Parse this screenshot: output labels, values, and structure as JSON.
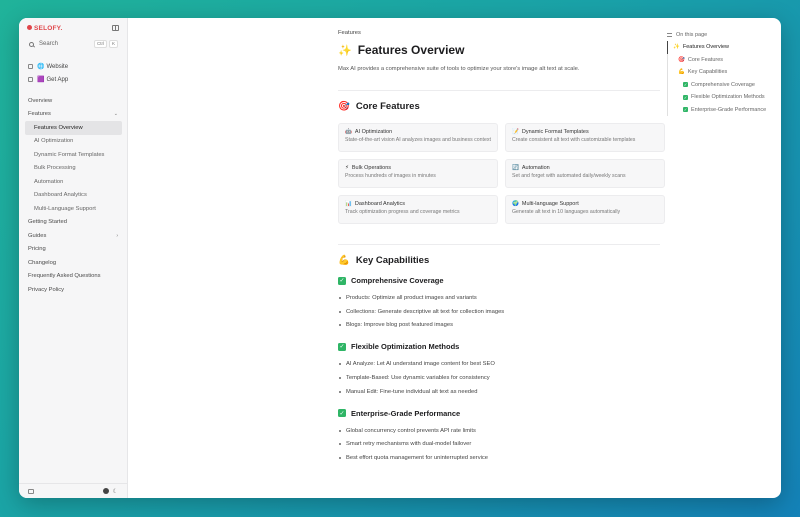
{
  "sidebar": {
    "brand": "SELOFY.",
    "search": {
      "placeholder": "Search",
      "kbd_ctrl": "Ctrl",
      "kbd_k": "K"
    },
    "links": [
      {
        "emoji": "🌐",
        "label": "Website"
      },
      {
        "emoji": "🟪",
        "label": "Get App"
      }
    ],
    "nav": [
      {
        "label": "Overview"
      },
      {
        "label": "Features",
        "chevron": "⌄"
      },
      {
        "label": "Features Overview"
      },
      {
        "label": "AI Optimization"
      },
      {
        "label": "Dynamic Format Templates"
      },
      {
        "label": "Bulk Processing"
      },
      {
        "label": "Automation"
      },
      {
        "label": "Dashboard Analytics"
      },
      {
        "label": "Multi-Language Support"
      },
      {
        "label": "Getting Started"
      },
      {
        "label": "Guides",
        "chevron": "›"
      },
      {
        "label": "Pricing"
      },
      {
        "label": "Changelog"
      },
      {
        "label": "Frequently Asked Questions"
      },
      {
        "label": "Privacy Policy"
      }
    ]
  },
  "main": {
    "breadcrumb": "Features",
    "title_emoji": "✨",
    "title": "Features Overview",
    "lede": "Max AI provides a comprehensive suite of tools to optimize your store's image alt text at scale.",
    "core": {
      "emoji": "🎯",
      "title": "Core Features",
      "cards": [
        {
          "icon": "🤖",
          "title": "AI Optimization",
          "desc": "State-of-the-art vision AI analyzes images and business context"
        },
        {
          "icon": "📝",
          "title": "Dynamic Format Templates",
          "desc": "Create consistent alt text with customizable templates"
        },
        {
          "icon": "⚡",
          "title": "Bulk Operations",
          "desc": "Process hundreds of images in minutes"
        },
        {
          "icon": "🔄",
          "title": "Automation",
          "desc": "Set and forget with automated daily/weekly scans"
        },
        {
          "icon": "📊",
          "title": "Dashboard Analytics",
          "desc": "Track optimization progress and coverage metrics"
        },
        {
          "icon": "🌍",
          "title": "Multi-language Support",
          "desc": "Generate alt text in 10 languages automatically"
        }
      ]
    },
    "capabilities": {
      "emoji": "💪",
      "title": "Key Capabilities",
      "groups": [
        {
          "title": "Comprehensive Coverage",
          "items": [
            "Products: Optimize all product images and variants",
            "Collections: Generate descriptive alt text for collection images",
            "Blogs: Improve blog post featured images"
          ]
        },
        {
          "title": "Flexible Optimization Methods",
          "items": [
            "AI Analyze: Let AI understand image content for best SEO",
            "Template-Based: Use dynamic variables for consistency",
            "Manual Edit: Fine-tune individual alt text as needed"
          ]
        },
        {
          "title": "Enterprise-Grade Performance",
          "items": [
            "Global concurrency control prevents API rate limits",
            "Smart retry mechanisms with dual-model failover",
            "Best effort quota management for uninterrupted service"
          ]
        }
      ]
    }
  },
  "toc": {
    "heading": "On this page",
    "items": [
      {
        "icon": "✨",
        "label": "Features Overview"
      },
      {
        "icon": "🎯",
        "label": "Core Features"
      },
      {
        "icon": "💪",
        "label": "Key Capabilities"
      },
      {
        "check": "✓",
        "label": "Comprehensive Coverage"
      },
      {
        "check": "✓",
        "label": "Flexible Optimization Methods"
      },
      {
        "check": "✓",
        "label": "Enterprise-Grade Performance"
      }
    ]
  },
  "colors": {
    "accent_brand": "#e0454a",
    "check_green": "#2fb566",
    "bg_gradient_start": "#20b39a",
    "bg_gradient_end": "#1482b8"
  },
  "check_glyph": "✓"
}
